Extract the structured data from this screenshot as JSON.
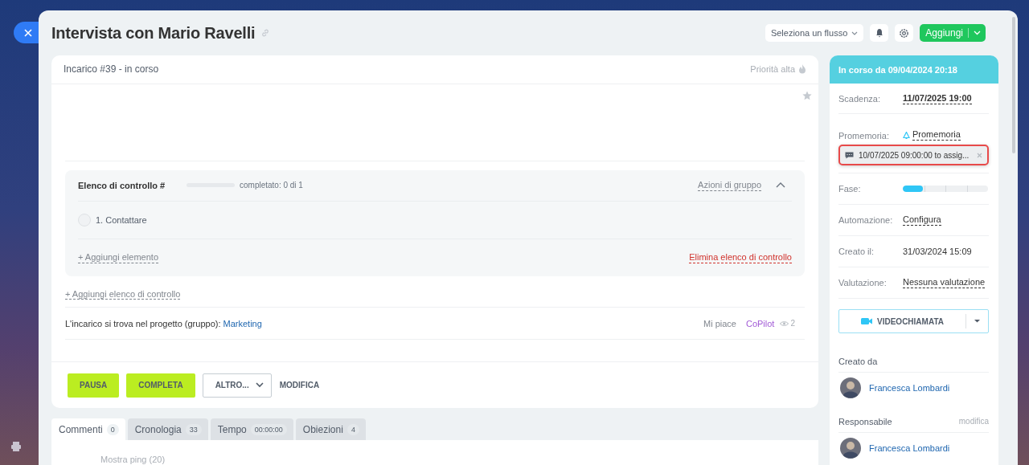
{
  "header": {
    "title": "Intervista con Mario Ravelli",
    "flow_select": "Seleziona un flusso",
    "add_button": "Aggiungi"
  },
  "task": {
    "status_line": "Incarico #39 - in corso",
    "priority": "Priorità alta",
    "starred": false,
    "checklist": {
      "title": "Elenco di controllo #",
      "level": 0,
      "progress_text": "completato: 0 di 1",
      "group_actions": "Azioni di gruppo",
      "expanded": true,
      "items": [
        {
          "label": "1. Contattare",
          "checked": false
        }
      ],
      "add_item": "+ Aggiungi elemento",
      "delete": "Elimina elenco di controllo"
    },
    "add_checklist": "+ Aggiungi elenco di controllo",
    "project_label": "L'incarico si trova nel progetto (gruppo):",
    "project": "Marketing",
    "like": "Mi piace",
    "copilot": "CoPilot",
    "views": "2",
    "actions": [
      {
        "label": "PAUSA",
        "kind": "primary"
      },
      {
        "label": "COMPLETA",
        "kind": "primary"
      },
      {
        "label": "ALTRO...",
        "kind": "dropdown"
      },
      {
        "label": "MODIFICA",
        "kind": "link"
      }
    ]
  },
  "tabs": [
    {
      "label": "Commenti",
      "count": "0",
      "selected": true
    },
    {
      "label": "Cronologia",
      "count": "33",
      "selected": false
    },
    {
      "label": "Tempo",
      "count": "00:00:00",
      "selected": false
    },
    {
      "label": "Obiezioni",
      "count": "4",
      "selected": false
    }
  ],
  "comments": {
    "show_pings": "Mostra ping (20)"
  },
  "sidebar": {
    "status": "In corso da 09/04/2024 20:18",
    "fields": [
      {
        "kind": "date",
        "label": "Scadenza:",
        "value": "11/07/2025 19:00"
      },
      {
        "kind": "reminder",
        "label": "Promemoria:",
        "value": "Promemoria",
        "reminders": [
          "10/07/2025 09:00:00 to assig..."
        ]
      },
      {
        "kind": "stage",
        "label": "Fase:",
        "level": 0.24
      },
      {
        "kind": "link",
        "label": "Automazione:",
        "value": "Configura"
      },
      {
        "kind": "plain",
        "label": "Creato il:",
        "value": "31/03/2024 15:09"
      },
      {
        "kind": "link",
        "label": "Valutazione:",
        "value": "Nessuna valutazione"
      }
    ],
    "video_call": "VIDEOCHIAMATA",
    "people": [
      {
        "heading": "Creato da",
        "name": "Francesca Lombardi"
      },
      {
        "heading": "Responsabile",
        "action": "modifica",
        "name": "Francesca Lombardi"
      }
    ]
  }
}
